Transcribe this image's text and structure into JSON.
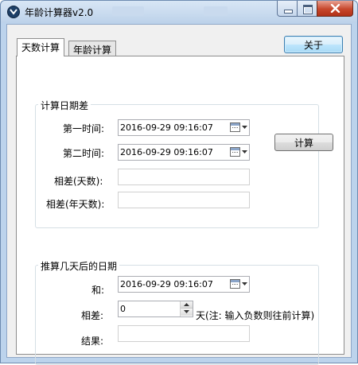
{
  "window": {
    "title": "年龄计算器v2.0",
    "icons": {
      "app": "chevron-down-circle-icon",
      "close": "close-icon"
    }
  },
  "tabs": [
    {
      "label": "天数计算",
      "active": true
    },
    {
      "label": "年龄计算",
      "active": false
    }
  ],
  "toolbar": {
    "about_label": "关于"
  },
  "diff_group": {
    "legend": "计算日期差",
    "first_time_label": "第一时间:",
    "first_time_value": "2016-09-29 09:16:07",
    "second_time_label": "第二时间:",
    "second_time_value": "2016-09-29 09:16:07",
    "calc_label": "计算",
    "diff_days_label": "相差(天数):",
    "diff_days_value": "",
    "diff_years_label": "相差(年天数):",
    "diff_years_value": ""
  },
  "future_group": {
    "legend": "推算几天后的日期",
    "and_label": "和:",
    "and_value": "2016-09-29 09:16:07",
    "offset_label": "相差:",
    "offset_value": "0",
    "offset_note": "天(注: 输入负数则往前计算)",
    "result_label": "结果:",
    "result_value": ""
  }
}
